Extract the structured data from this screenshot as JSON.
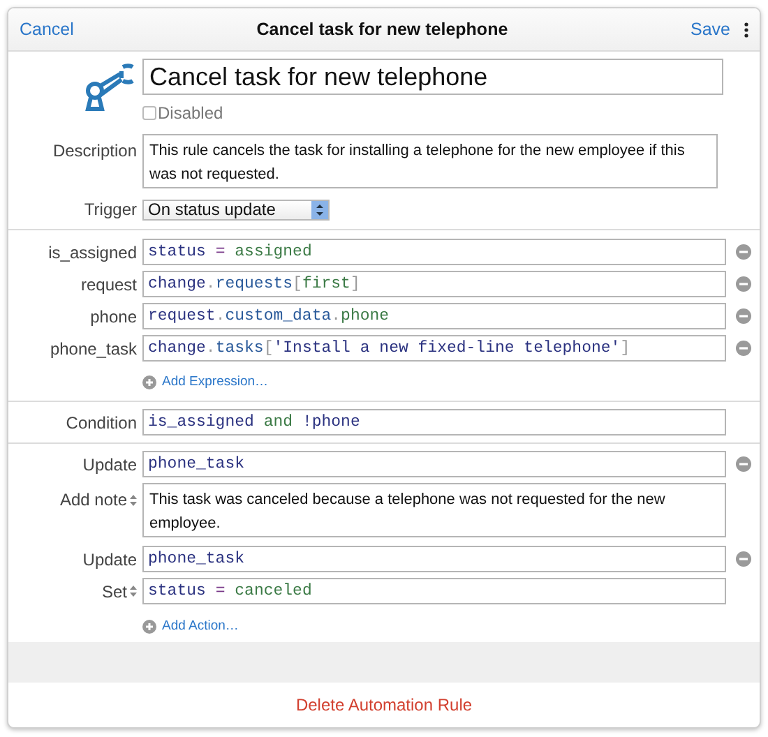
{
  "header": {
    "cancel": "Cancel",
    "title": "Cancel task for new telephone",
    "save": "Save"
  },
  "rule": {
    "name": "Cancel task for new telephone",
    "disabled": {
      "label": "Disabled",
      "checked": false
    },
    "description_label": "Description",
    "description": "This rule cancels the task for installing a telephone for the new employee if this was not requested.",
    "trigger_label": "Trigger",
    "trigger": "On status update"
  },
  "expressions": [
    {
      "name": "is_assigned",
      "code": [
        {
          "kind": "name",
          "text": "status"
        },
        {
          "kind": "op",
          "text": " = "
        },
        {
          "kind": "value",
          "text": "assigned"
        }
      ]
    },
    {
      "name": "request",
      "code": [
        {
          "kind": "name",
          "text": "change"
        },
        {
          "kind": "punct",
          "text": "."
        },
        {
          "kind": "prop",
          "text": "requests"
        },
        {
          "kind": "punct",
          "text": "["
        },
        {
          "kind": "value",
          "text": "first"
        },
        {
          "kind": "punct",
          "text": "]"
        }
      ]
    },
    {
      "name": "phone",
      "code": [
        {
          "kind": "name",
          "text": "request"
        },
        {
          "kind": "punct",
          "text": "."
        },
        {
          "kind": "prop",
          "text": "custom_data"
        },
        {
          "kind": "punct",
          "text": "."
        },
        {
          "kind": "value",
          "text": "phone"
        }
      ]
    },
    {
      "name": "phone_task",
      "code": [
        {
          "kind": "name",
          "text": "change"
        },
        {
          "kind": "punct",
          "text": "."
        },
        {
          "kind": "prop",
          "text": "tasks"
        },
        {
          "kind": "punct",
          "text": "["
        },
        {
          "kind": "name",
          "text": "'Install a new fixed-line telephone'"
        },
        {
          "kind": "punct",
          "text": "]"
        }
      ]
    }
  ],
  "add_expression": "Add Expression…",
  "condition": {
    "label": "Condition",
    "code": [
      {
        "kind": "name",
        "text": "is_assigned "
      },
      {
        "kind": "value",
        "text": "and"
      },
      {
        "kind": "name",
        "text": " !phone"
      }
    ]
  },
  "actions": [
    {
      "kind": "code",
      "label": "Update",
      "stepper": false,
      "removable": true,
      "code": [
        {
          "kind": "name",
          "text": "phone_task"
        }
      ]
    },
    {
      "kind": "text",
      "label": "Add note",
      "stepper": true,
      "removable": false,
      "text": "This task was canceled because a telephone was not requested for the new employee."
    },
    {
      "kind": "code",
      "label": "Update",
      "stepper": false,
      "removable": true,
      "code": [
        {
          "kind": "name",
          "text": "phone_task"
        }
      ]
    },
    {
      "kind": "code",
      "label": "Set",
      "stepper": true,
      "removable": false,
      "code": [
        {
          "kind": "name",
          "text": "status"
        },
        {
          "kind": "op",
          "text": " = "
        },
        {
          "kind": "value",
          "text": "canceled"
        }
      ]
    }
  ],
  "add_action": "Add Action…",
  "delete": "Delete Automation Rule"
}
